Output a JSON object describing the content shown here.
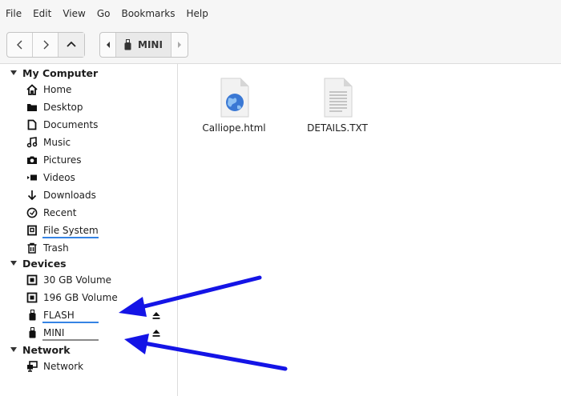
{
  "menubar": {
    "items": [
      "File",
      "Edit",
      "View",
      "Go",
      "Bookmarks",
      "Help"
    ]
  },
  "toolbar": {
    "back_icon": "chevron-left-icon",
    "forward_icon": "chevron-right-icon",
    "up_icon": "chevron-up-icon",
    "path_crumb": "MINI"
  },
  "sidebar": {
    "sections": {
      "my_computer": "My Computer",
      "devices": "Devices",
      "network": "Network"
    },
    "my_computer_items": [
      {
        "label": "Home",
        "icon": "home-icon"
      },
      {
        "label": "Desktop",
        "icon": "folder-icon"
      },
      {
        "label": "Documents",
        "icon": "document-icon"
      },
      {
        "label": "Music",
        "icon": "music-icon"
      },
      {
        "label": "Pictures",
        "icon": "camera-icon"
      },
      {
        "label": "Videos",
        "icon": "video-icon"
      },
      {
        "label": "Downloads",
        "icon": "download-icon"
      },
      {
        "label": "Recent",
        "icon": "clock-icon"
      },
      {
        "label": "File System",
        "icon": "drive-icon"
      },
      {
        "label": "Trash",
        "icon": "trash-icon"
      }
    ],
    "device_items": [
      {
        "label": "30 GB Volume",
        "icon": "disk-icon"
      },
      {
        "label": "196 GB Volume",
        "icon": "disk-icon"
      },
      {
        "label": "FLASH",
        "icon": "usb-icon"
      },
      {
        "label": "MINI",
        "icon": "usb-icon"
      }
    ],
    "network_items": [
      {
        "label": "Network",
        "icon": "network-icon"
      }
    ]
  },
  "main": {
    "files": [
      {
        "name": "Calliope.html",
        "icon": "html-file-icon"
      },
      {
        "name": "DETAILS.TXT",
        "icon": "text-file-icon"
      }
    ]
  },
  "colors": {
    "accent": "#2f6fd0",
    "arrow": "#1414e6",
    "underline_blue": "#3584e4",
    "underline_gray": "#8a8a8a"
  }
}
